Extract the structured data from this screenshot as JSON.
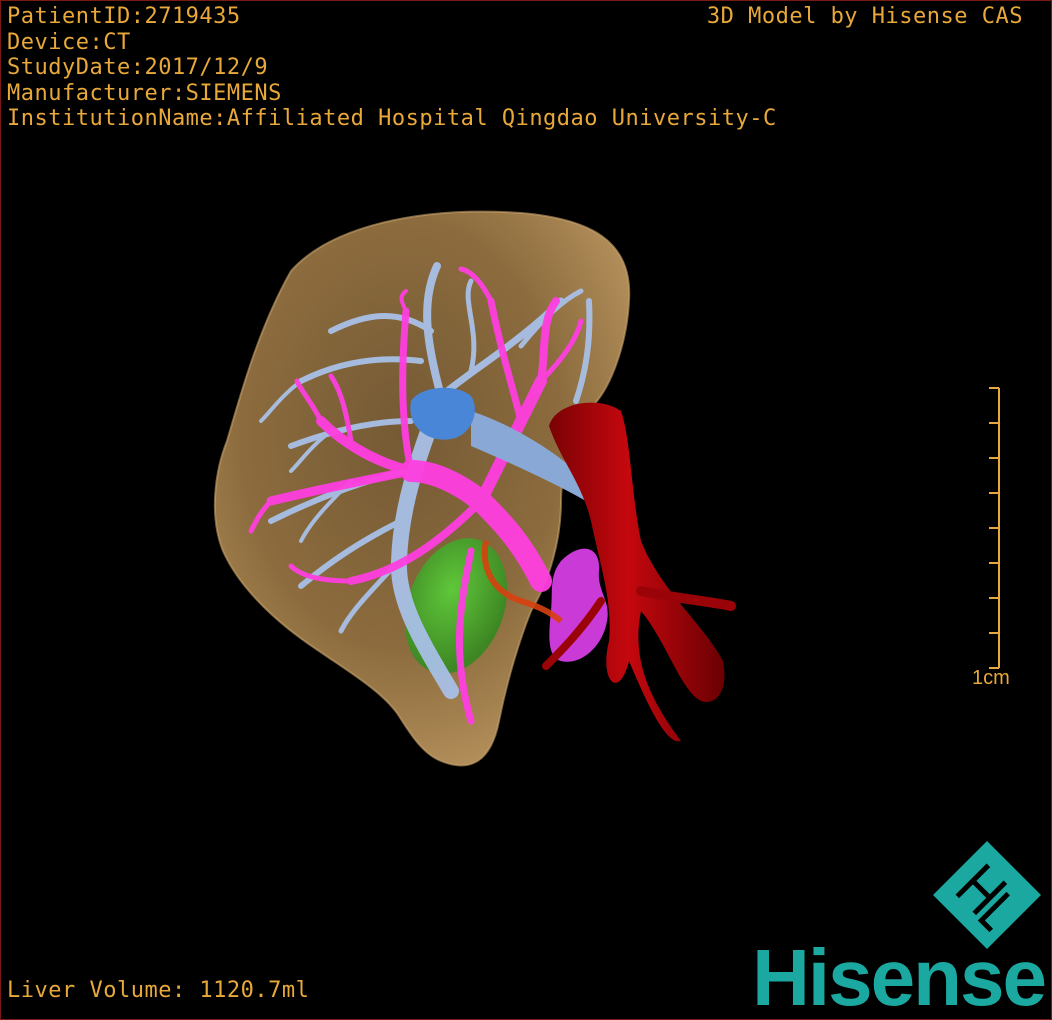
{
  "header": {
    "patient_id": "PatientID:2719435",
    "device": "Device:CT",
    "study_date": "StudyDate:2017/12/9",
    "manufacturer": "Manufacturer:SIEMENS",
    "institution": "InstitutionName:Affiliated Hospital Qingdao University-C"
  },
  "credit": "3D Model by Hisense CAS",
  "scale": {
    "label": "1cm"
  },
  "footer": {
    "liver_volume": "Liver Volume: 1120.7ml"
  },
  "brand": {
    "wordmark": "Hisense",
    "mark": "HL",
    "color": "#1aa8a0"
  },
  "colors": {
    "text": "#e8a83a",
    "liver": "#a07a44",
    "portal_vein": "#ff3ee0",
    "hepatic_vein": "#a8c0e6",
    "ivc_stump": "#4a86d8",
    "aorta": "#b0060a",
    "gallbladder": "#3fb82a",
    "pancreas": "#e040ee",
    "artery": "#d84010"
  },
  "structures": [
    "liver",
    "hepatic-veins",
    "portal-veins",
    "inferior-vena-cava",
    "aorta",
    "gallbladder",
    "pancreas",
    "hepatic-artery"
  ]
}
